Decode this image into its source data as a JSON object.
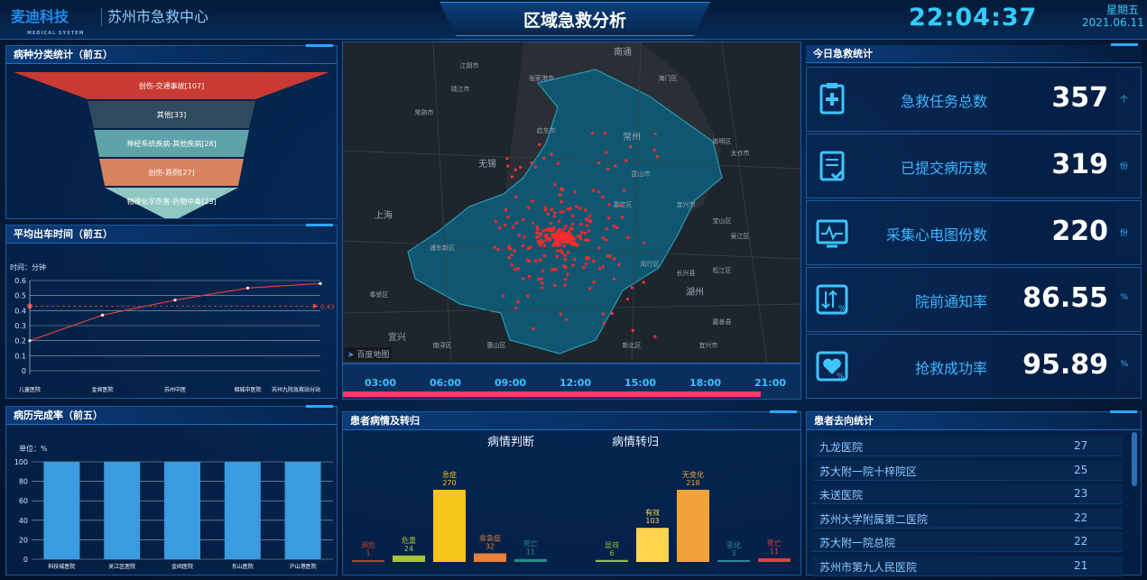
{
  "header": {
    "logo_text": "麦迪科技",
    "logo_sub": "MEDICAL SYSTEM",
    "org_name": "苏州市急救中心",
    "title": "区域急救分析",
    "time": "22:04:37",
    "weekday": "星期五",
    "date": "2021.06.11"
  },
  "disease_panel": {
    "title": "病种分类统计（前五）",
    "items": [
      {
        "label": "创伤-交通事故[107]",
        "color": "#c93a32"
      },
      {
        "label": "其他[33]",
        "color": "#2f4a5e"
      },
      {
        "label": "神经系统疾病-其他疾病[28]",
        "color": "#5fa3a8"
      },
      {
        "label": "创伤-跌倒[27]",
        "color": "#d9825e"
      },
      {
        "label": "物理化学伤害-药物中毒[23]",
        "color": "#8fc7c2"
      }
    ]
  },
  "dispatch_panel": {
    "title": "平均出车时间（前五）",
    "chart_data": {
      "type": "line",
      "ylabel": "时间：分钟",
      "ylim": [
        0,
        0.6
      ],
      "yticks": [
        "0",
        "0.1",
        "0.2",
        "0.3",
        "0.4",
        "0.5",
        "0.6"
      ],
      "categories": [
        "儿童医院",
        "金阊医院",
        "苏州中医",
        "相城中医院",
        "苏州九院急救站分站"
      ],
      "values": [
        0.2,
        0.37,
        0.47,
        0.55,
        0.58
      ],
      "markline": {
        "value": 0.43,
        "label": "0.43"
      },
      "color": "#e0453a"
    }
  },
  "record_panel": {
    "title": "病历完成率（前五）",
    "chart_data": {
      "type": "bar",
      "ylabel": "单位：%",
      "ylim": [
        0,
        100
      ],
      "yticks": [
        "0",
        "20",
        "40",
        "60",
        "80",
        "100"
      ],
      "categories": [
        "科技城医院",
        "吴江区医院",
        "金阊医院",
        "东山医院",
        "沪山港医院"
      ],
      "values": [
        100,
        100,
        100,
        100,
        100
      ],
      "color": "#3a9be0"
    }
  },
  "map": {
    "cities": [
      "南通",
      "江阴市",
      "张家港市",
      "海门区",
      "靖江市",
      "常熟市",
      "启东市",
      "常州",
      "崇明区",
      "无锡",
      "太仓市",
      "昆山市",
      "嘉定区",
      "宜兴市",
      "宝山区",
      "上海",
      "吴江区",
      "浦东新区",
      "闵行区",
      "长兴县",
      "松江区",
      "奉贤区",
      "湖州",
      "嘉善县",
      "南浔区",
      "新北区",
      "惠山区",
      "宜兴市",
      "宜兴"
    ],
    "watermark": "百度地图",
    "timeline": [
      "03:00",
      "06:00",
      "09:00",
      "12:00",
      "15:00",
      "18:00",
      "21:00"
    ],
    "progress": 0.91
  },
  "patient_panel": {
    "title": "患者病情及转归",
    "left_title": "病情判断",
    "right_title": "病情转归",
    "chart_data": [
      {
        "type": "bar",
        "title": "病情判断",
        "categories": [
          "濒危",
          "危重",
          "急症",
          "非急症",
          "死亡"
        ],
        "values": [
          1,
          24,
          270,
          32,
          11
        ],
        "colors": [
          "#c93a32",
          "#a8c437",
          "#f5c518",
          "#e8803a",
          "#2a8a8a"
        ]
      },
      {
        "type": "bar",
        "title": "病情转归",
        "categories": [
          "显效",
          "有效",
          "无变化",
          "恶化",
          "死亡"
        ],
        "values": [
          6,
          103,
          218,
          3,
          11
        ],
        "colors": [
          "#8bc34a",
          "#ffd54f",
          "#f0a33a",
          "#2a8a9a",
          "#e04040"
        ]
      }
    ]
  },
  "today_panel": {
    "title": "今日急救统计",
    "stats": [
      {
        "label": "急救任务总数",
        "value": "357",
        "unit": "个",
        "icon": "clipboard-plus-icon"
      },
      {
        "label": "已提交病历数",
        "value": "319",
        "unit": "份",
        "icon": "document-check-icon"
      },
      {
        "label": "采集心电图份数",
        "value": "220",
        "unit": "份",
        "icon": "ecg-monitor-icon"
      },
      {
        "label": "院前通知率",
        "value": "86.55",
        "unit": "%",
        "icon": "sort-percent-icon"
      },
      {
        "label": "抢救成功率",
        "value": "95.89",
        "unit": "%",
        "icon": "heart-percent-icon"
      }
    ]
  },
  "destination_panel": {
    "title": "患者去向统计",
    "rows": [
      {
        "name": "九龙医院",
        "count": "27"
      },
      {
        "name": "苏大附一院十梓院区",
        "count": "25"
      },
      {
        "name": "未送医院",
        "count": "23"
      },
      {
        "name": "苏州大学附属第二医院",
        "count": "22"
      },
      {
        "name": "苏大附一院总院",
        "count": "22"
      },
      {
        "name": "苏州市第九人民医院",
        "count": "21"
      }
    ]
  }
}
